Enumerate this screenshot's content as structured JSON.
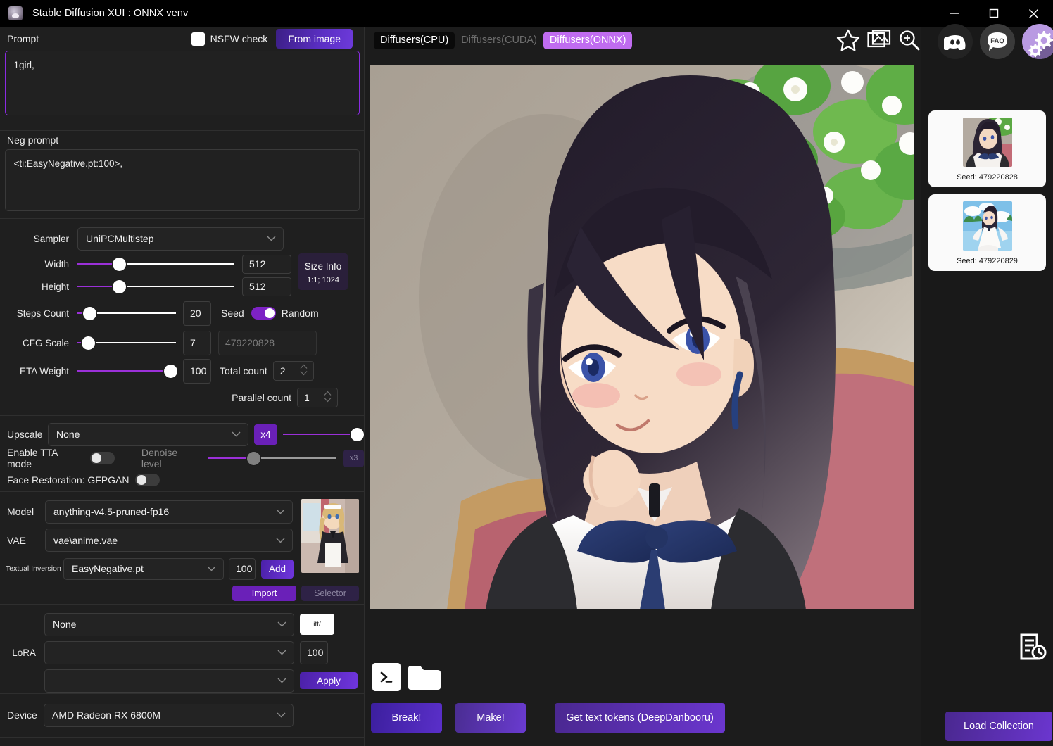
{
  "window": {
    "title": "Stable Diffusion XUI : ONNX venv",
    "app_icon": "app-avatar-icon",
    "minimize": "minimize-icon",
    "maximize": "maximize-icon",
    "close": "close-icon"
  },
  "prompt_section": {
    "prompt_label": "Prompt",
    "nsfw_label": "NSFW check",
    "nsfw_checked": false,
    "from_image_button": "From image",
    "prompt_value": "1girl,",
    "neg_label": "Neg prompt",
    "neg_value": "<ti:EasyNegative.pt:100>,"
  },
  "params": {
    "sampler_label": "Sampler",
    "sampler_value": "UniPCMultistep",
    "width_label": "Width",
    "width_value": "512",
    "height_label": "Height",
    "height_value": "512",
    "size_info_label": "Size Info",
    "size_info_value": "1:1; 1024",
    "steps_label": "Steps Count",
    "steps_value": "20",
    "seed_label": "Seed",
    "random_label": "Random",
    "random_on": true,
    "seed_placeholder": "479220828",
    "cfg_label": "CFG Scale",
    "cfg_value": "7",
    "eta_label": "ETA Weight",
    "eta_value": "100",
    "total_count_label": "Total count",
    "total_count_value": "2",
    "parallel_count_label": "Parallel count",
    "parallel_count_value": "1"
  },
  "upscale": {
    "upscale_label": "Upscale",
    "upscale_value": "None",
    "x4_button": "x4",
    "tta_label": "Enable TTA mode",
    "tta_on": false,
    "denoise_label": "Denoise level",
    "x3_button": "x3",
    "face_label": "Face Restoration: GFPGAN",
    "face_on": false
  },
  "model": {
    "model_label": "Model",
    "model_value": "anything-v4.5-pruned-fp16",
    "vae_label": "VAE",
    "vae_value": "vae\\anime.vae",
    "ti_label": "Textual Inversion",
    "ti_value": "EasyNegative.pt",
    "ti_weight": "100",
    "add_button": "Add",
    "import_button": "Import",
    "selector_button": "Selector"
  },
  "lora": {
    "lora_label": "LoRA",
    "row1_value": "None",
    "row2_value": "",
    "row3_value": "",
    "weight_value": "100",
    "small_button": "itt/",
    "apply_button": "Apply"
  },
  "device": {
    "device_label": "Device",
    "device_value": "AMD Radeon RX 6800M"
  },
  "toolbar_icons": {
    "star": "star-icon",
    "gallery": "gallery-icon",
    "zoom": "zoom-in-icon",
    "discord": "discord-icon",
    "faq": "faq-icon",
    "settings": "settings-gears-icon"
  },
  "tabs": [
    {
      "label": "Diffusers(CPU)",
      "state": "inactive-dark"
    },
    {
      "label": "Diffusers(CUDA)",
      "state": "disabled"
    },
    {
      "label": "Diffusers(ONNX)",
      "state": "active"
    }
  ],
  "bottom": {
    "terminal_icon": "terminal-icon",
    "folder_icon": "folder-icon",
    "break_button": "Break!",
    "make_button": "Make!",
    "tokens_button": "Get text tokens (DeepDanbooru)",
    "load_collection_button": "Load Collection",
    "history_icon": "history-log-icon"
  },
  "results": [
    {
      "seed_label": "Seed: 479220828",
      "scene": "indoor-portrait"
    },
    {
      "seed_label": "Seed: 479220829",
      "scene": "outdoor-sky"
    }
  ],
  "colors": {
    "accent_purple": "#8a2be2",
    "tab_active": "#c06cf0",
    "button_purple": "#6f35dd",
    "panel_bg": "#1f1f1f",
    "window_bg": "#1c1c1c"
  }
}
